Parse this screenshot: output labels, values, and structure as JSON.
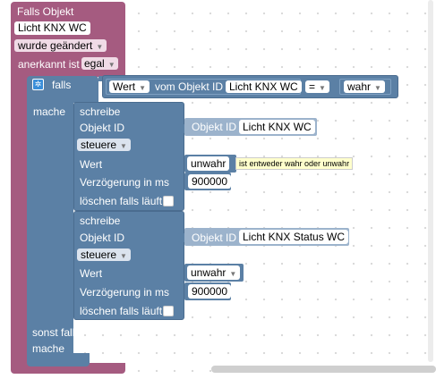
{
  "event_block": {
    "title": "Falls Objekt",
    "object_name": "Licht KNX WC",
    "trigger": "wurde geändert",
    "ack_label": "anerkannt ist",
    "ack_value": "egal"
  },
  "if_block": {
    "falls_label": "falls",
    "mache_label": "mache",
    "sonst_falls_label": "sonst falls",
    "mache2_label": "mache",
    "condition": {
      "property": "Wert",
      "from_label": "vom Objekt ID",
      "object": "Licht KNX WC",
      "operator": "=",
      "value": "wahr"
    }
  },
  "write_blocks": [
    {
      "title": "schreibe",
      "object_id_label": "Objekt ID",
      "object_id_chip": "Objekt ID",
      "object_id_value": "Licht KNX WC",
      "mode": "steuere",
      "value_label": "Wert",
      "value": "unwahr",
      "delay_label": "Verzögerung in ms",
      "delay_value": "900000",
      "clear_label": "löschen falls läuft"
    },
    {
      "title": "schreibe",
      "object_id_label": "Objekt ID",
      "object_id_chip": "Objekt ID",
      "object_id_value": "Licht KNX Status WC",
      "mode": "steuere",
      "value_label": "Wert",
      "value": "unwahr",
      "delay_label": "Verzögerung in ms",
      "delay_value": "900000",
      "clear_label": "löschen falls läuft"
    }
  ],
  "tooltip": "ist entweder wahr oder unwahr",
  "colors": {
    "event": "#a55b80",
    "logic": "#5b80a5",
    "logic_light": "#9cb3cc",
    "field_bg": "#ffffff"
  }
}
